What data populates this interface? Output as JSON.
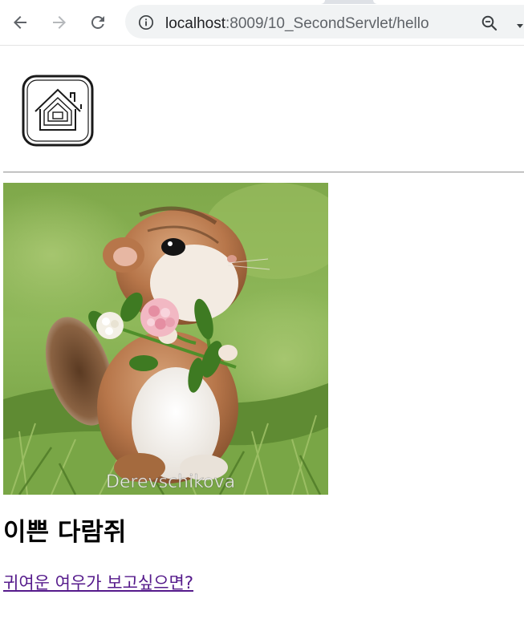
{
  "browser": {
    "url_host": "localhost",
    "url_path": ":8009/10_SecondServlet/hello",
    "icons": {
      "back": "back-arrow-icon",
      "forward": "forward-arrow-icon",
      "reload": "reload-icon",
      "site_info": "info-icon",
      "zoom": "zoom-icon",
      "extension": "dropdown-arrow-icon"
    }
  },
  "page": {
    "logo_icon": "home-icon",
    "image_watermark": "Derevschikova",
    "image_subject": "chipmunk-holding-clover-flowers",
    "heading": "이쁜 다람쥐",
    "link_text": "귀여운 여우가 보고싶으면?"
  },
  "colors": {
    "link_visited": "#551a8b",
    "omnibox_bg": "#f1f3f4",
    "divider": "#9a9a9a"
  }
}
